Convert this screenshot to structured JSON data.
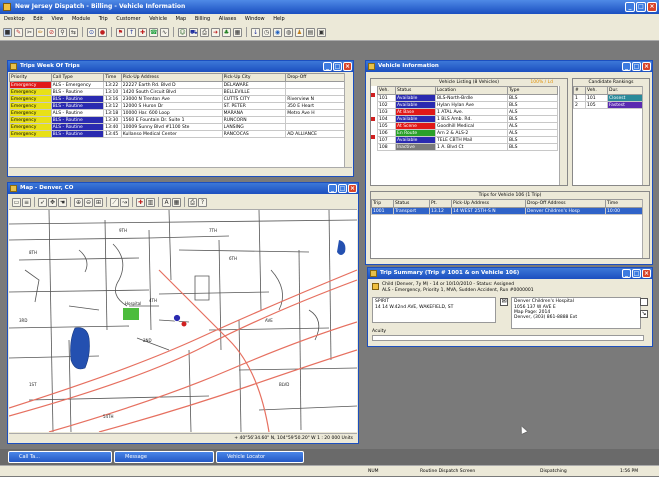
{
  "app": {
    "title": "New Jersey Dispatch - Billing - Vehicle Information",
    "menu": [
      "Desktop",
      "Edit",
      "View",
      "Module",
      "Trip",
      "Customer",
      "Vehicle",
      "Map",
      "Billing",
      "Aliases",
      "Window",
      "Help"
    ]
  },
  "trips": {
    "title": "Trips Week Of Trips",
    "columns": [
      "Priority",
      "Call Type",
      "Time",
      "Pick-Up Address",
      "Pick-Up City",
      "Drop-Off"
    ],
    "rows": [
      {
        "priority": "Emergency",
        "type": "ALS - Emergency",
        "time": "13:22",
        "addr": "22227 Earth Rd. Blvd D",
        "city": "DELAWARE",
        "drop": "",
        "pcolor": "#e01818",
        "tcolor": "#ffffff"
      },
      {
        "priority": "Emergency",
        "type": "BLS - Routine",
        "time": "13:10",
        "addr": "1420 South Circuit Blvd",
        "city": "BELLEVILLE",
        "drop": "",
        "pcolor": "#e8e018",
        "tcolor": "#ffffff"
      },
      {
        "priority": "Emergency",
        "type": "BLS - Routine",
        "time": "13:16",
        "addr": "23000 N Trenton Ave",
        "city": "CUTTS CITY",
        "drop": "Riverview N",
        "pcolor": "#e8e018",
        "tcolor": "#2a2ab0"
      },
      {
        "priority": "Emergency",
        "type": "BLS - Routine",
        "time": "13:12",
        "addr": "12000 S Huron Dr",
        "city": "ST. PETER",
        "drop": "350 E Heart",
        "pcolor": "#e8e018",
        "tcolor": "#2a2ab0"
      },
      {
        "priority": "Emergency",
        "type": "ALS - Routine",
        "time": "13:18",
        "addr": "10000 Har. 600 Loop",
        "city": "MARANA",
        "drop": "Metro Ave H",
        "pcolor": "#e8e018",
        "tcolor": "#ffffff"
      },
      {
        "priority": "Emergency",
        "type": "BLS - Routine",
        "time": "13:30",
        "addr": "1560 E Fountain Dr. Suite 1",
        "city": "RUNCORN",
        "drop": "",
        "pcolor": "#e8e018",
        "tcolor": "#2a2ab0"
      },
      {
        "priority": "Emergency",
        "type": "ALS - Routine",
        "time": "13:40",
        "addr": "10009 Sunny Blvd #1100 Ste",
        "city": "LANSING",
        "drop": "",
        "pcolor": "#e8e018",
        "tcolor": "#2a2ab0"
      },
      {
        "priority": "Emergency",
        "type": "BLS - Routine",
        "time": "13:45",
        "addr": "Kullanso Medical Center",
        "city": "RANCOCAS",
        "drop": "AD ALLIANCE",
        "pcolor": "#e8e018",
        "tcolor": "#2a2ab0"
      }
    ]
  },
  "vehicle": {
    "title": "Vehicle Information",
    "listing_label": "Vehicle Listing (8 Vehicles)",
    "filter_label": "100% / Ld",
    "columns": [
      "Veh.",
      "Status",
      "Location",
      "Type"
    ],
    "rows": [
      {
        "veh": "101",
        "status": "Available",
        "loc": "BLS-North-Brdle",
        "type": "BLS",
        "scolor": "#2a2ab0"
      },
      {
        "veh": "102",
        "status": "Available",
        "loc": "Hylan Hylan Ave",
        "type": "BLS",
        "scolor": "#2a2ab0"
      },
      {
        "veh": "103",
        "status": "At Base",
        "loc": "1 ATAL Ave.",
        "type": "ALS",
        "scolor": "#e01818"
      },
      {
        "veh": "104",
        "status": "Available",
        "loc": "1 BLS Amb. Rd.",
        "type": "BLS",
        "scolor": "#2a2ab0"
      },
      {
        "veh": "105",
        "status": "At Scene",
        "loc": "Goodhill Medical",
        "type": "ALS",
        "scolor": "#e01818"
      },
      {
        "veh": "106",
        "status": "En Route",
        "loc": "Arn 2 & ALS-2",
        "type": "ALS",
        "scolor": "#2aa02a"
      },
      {
        "veh": "107",
        "status": "Available",
        "loc": "TELE CBTH Mail",
        "type": "BLS",
        "scolor": "#2a2ab0"
      },
      {
        "veh": "108",
        "status": "Inactive",
        "loc": "1 A. Blvd Ct",
        "type": "BLS",
        "scolor": "#7a7a7a"
      }
    ]
  },
  "candidate": {
    "title": "Candidate Rankings",
    "columns": [
      "#",
      "Veh.",
      "Dur."
    ],
    "rows": [
      {
        "rank": "1",
        "veh": "101",
        "dur": "Closest",
        "dcolor": "#2a8a9a"
      },
      {
        "rank": "2",
        "veh": "105",
        "dur": "Fastest",
        "dcolor": "#5a2ab0"
      }
    ]
  },
  "tripsVehicle": {
    "title": "Trips for Vehicle 106 (1 Trip)",
    "columns": [
      "Trip",
      "Status",
      "Pt.",
      "Pick-Up Address",
      "Drop-Off Address",
      "Time"
    ],
    "row": {
      "trip": "1001",
      "status": "Transport",
      "pt": "13.12",
      "pu": "14 WEST 25TH-S N",
      "do": "Denver Children's Hosp",
      "time": "10:00"
    }
  },
  "summary": {
    "title": "Trip Summary (Trip # 1001 & on Vehicle 106)",
    "line1": "Child (Denver, 7y M) - 14 or 10/10/2010 - Status: Assigned",
    "line2": "ALS - Emergency, Priority 1, MVA, Sudden Accident, Run #0000001",
    "pu_label": "SPIRIT",
    "pu_addr": "14 14 W.42nd AVE, WAKEFIELD, ST",
    "do_title": "Denver Children's Hospital",
    "do_addr": "1056 137 W AVE E",
    "mappage": "Map Page: 2014",
    "phone": "Denver, (303) 861-8888 Ext",
    "notes_label": "Acuity"
  },
  "map": {
    "title": "Map - Denver, CO",
    "status": "+ 40°56'34.60\" N, 104°59'50.20\" W    1 : 20 000 Units",
    "labels": [
      "9TH",
      "7TH",
      "8TH",
      "6TH",
      "4TH",
      "3RD",
      "2ND",
      "1ST",
      "AVE",
      "BLVD",
      "54TH",
      "Hospital"
    ]
  },
  "taskbar": {
    "items": [
      "Call Ta...",
      "Message",
      "Vehicle Locator"
    ],
    "status": [
      "NUM",
      "Routine Dispatch Screen",
      "Dispatching",
      "1:56 PM"
    ]
  }
}
